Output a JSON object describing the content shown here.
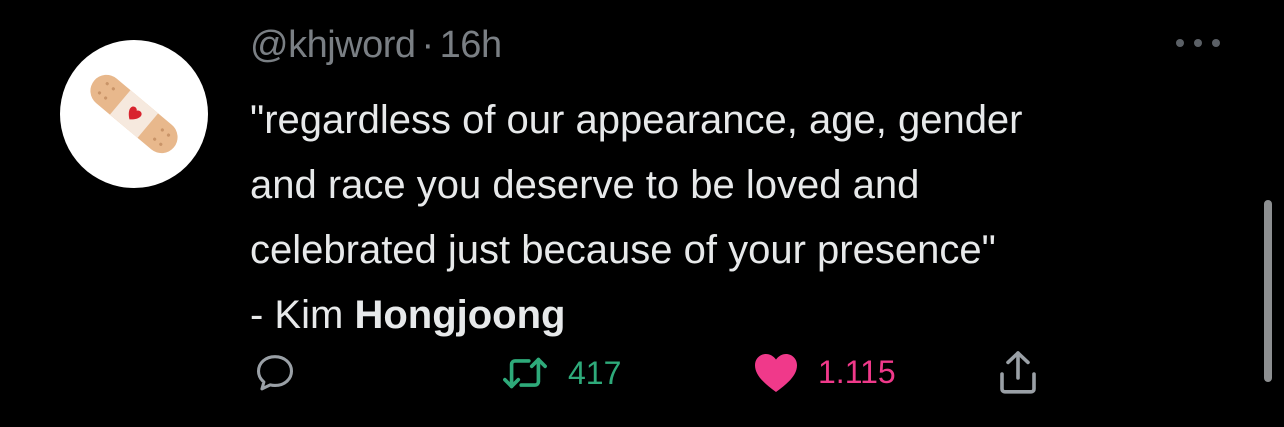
{
  "tweet": {
    "handle": "@khjword",
    "separator": "·",
    "time": "16h",
    "lines": [
      "\"regardless of our appearance, age, gender",
      "and race you deserve to be loved and",
      "celebrated just because of your presence\""
    ],
    "attribution_prefix": "- Kim ",
    "attribution_bold": "Hongjoong"
  },
  "actions": {
    "reply_icon": "reply-icon",
    "retweet_icon": "retweet-icon",
    "retweet_count": "417",
    "like_icon": "heart-icon",
    "like_count": "1.115",
    "share_icon": "share-icon"
  },
  "colors": {
    "background": "#000000",
    "text": "#e7e9ea",
    "muted": "#7a7f84",
    "retweet": "#2eaa7a",
    "like": "#f0398a"
  },
  "avatar": {
    "icon": "bandage-with-heart"
  }
}
